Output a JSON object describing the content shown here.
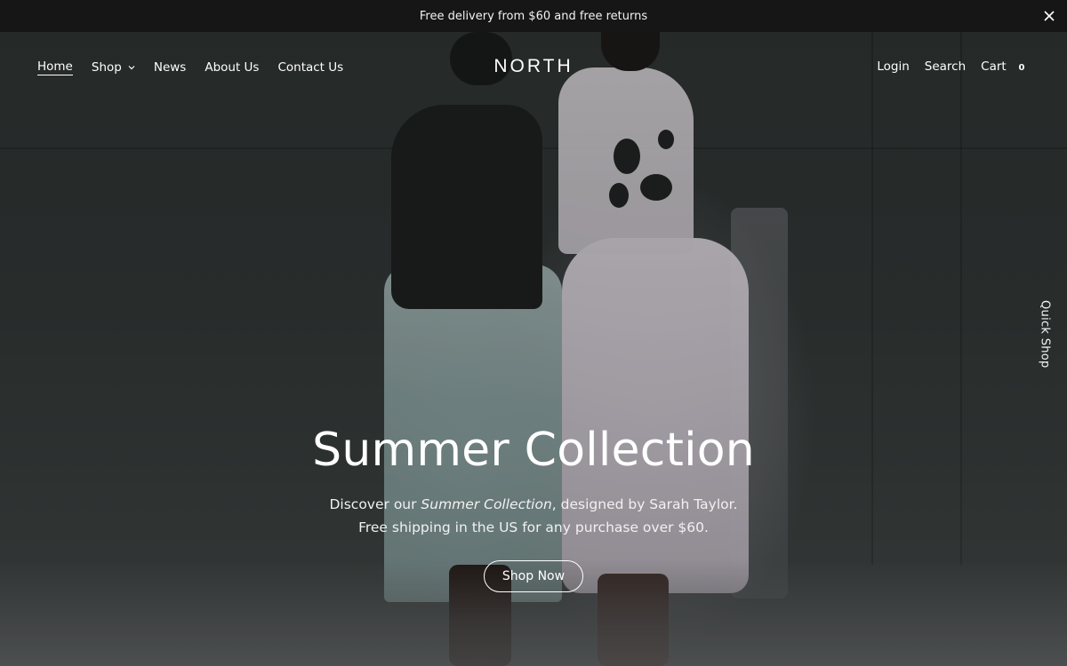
{
  "announcement": {
    "text": "Free delivery from $60 and free returns",
    "close_icon": "close-icon"
  },
  "header": {
    "logo": "NORTH",
    "nav_left": [
      {
        "label": "Home",
        "active": true
      },
      {
        "label": "Shop",
        "has_dropdown": true,
        "icon": "chevron-down-icon"
      },
      {
        "label": "News"
      },
      {
        "label": "About Us"
      },
      {
        "label": "Contact Us"
      }
    ],
    "nav_right": {
      "login": "Login",
      "search": "Search",
      "cart": "Cart",
      "cart_count": "0"
    }
  },
  "quick_shop": {
    "label": "Quick Shop"
  },
  "hero": {
    "title": "Summer Collection",
    "subtitle_prefix": "Discover our ",
    "subtitle_emphasis": "Summer Collection",
    "subtitle_suffix": ", designed by Sarah Taylor.",
    "subtitle_line2": "Free shipping in the US for any purchase over $60.",
    "cta_label": "Shop Now"
  },
  "colors": {
    "announcement_bg": "#161616",
    "text": "#ffffff",
    "hero_bg": "#2f3433"
  }
}
